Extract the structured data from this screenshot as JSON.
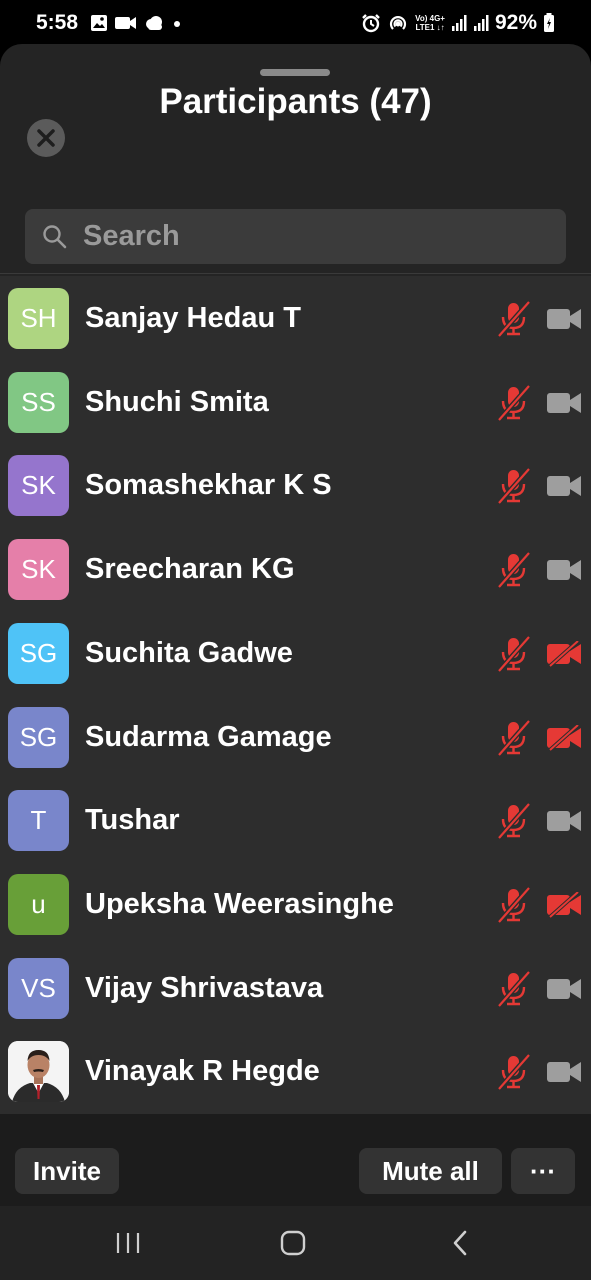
{
  "status_bar": {
    "time": "5:58",
    "battery_percent": "92%",
    "network_line1": "Vo) 4G+",
    "network_line2": "LTE1 ↓↑"
  },
  "header": {
    "title": "Participants (47)"
  },
  "search": {
    "placeholder": "Search"
  },
  "colors": {
    "sheet_bg": "#242424",
    "list_bg": "#2d2d2d",
    "muted_red": "#e53935",
    "cam_gray": "#9e9e9e"
  },
  "participants": [
    {
      "initials": "SH",
      "name": "Sanjay Hedau T",
      "avatar_color": "#aed581",
      "mic_muted": true,
      "video_off": false
    },
    {
      "initials": "SS",
      "name": "Shuchi Smita",
      "avatar_color": "#81c784",
      "mic_muted": true,
      "video_off": false
    },
    {
      "initials": "SK",
      "name": "Somashekhar K S",
      "avatar_color": "#9575cd",
      "mic_muted": true,
      "video_off": false
    },
    {
      "initials": "SK",
      "name": "Sreecharan KG",
      "avatar_color": "#e57fa9",
      "mic_muted": true,
      "video_off": false
    },
    {
      "initials": "SG",
      "name": "Suchita Gadwe",
      "avatar_color": "#4fc3f7",
      "mic_muted": true,
      "video_off": true
    },
    {
      "initials": "SG",
      "name": "Sudarma Gamage",
      "avatar_color": "#7986cb",
      "mic_muted": true,
      "video_off": true
    },
    {
      "initials": "T",
      "name": "Tushar",
      "avatar_color": "#7986cb",
      "mic_muted": true,
      "video_off": false
    },
    {
      "initials": "u",
      "name": "Upeksha Weerasinghe",
      "avatar_color": "#689f38",
      "mic_muted": true,
      "video_off": true
    },
    {
      "initials": "VS",
      "name": "Vijay Shrivastava",
      "avatar_color": "#7986cb",
      "mic_muted": true,
      "video_off": false
    },
    {
      "initials": "",
      "name": "Vinayak R Hegde",
      "avatar_photo": true,
      "mic_muted": true,
      "video_off": false
    }
  ],
  "footer": {
    "invite_label": "Invite",
    "mute_all_label": "Mute all",
    "more_label": "···"
  }
}
